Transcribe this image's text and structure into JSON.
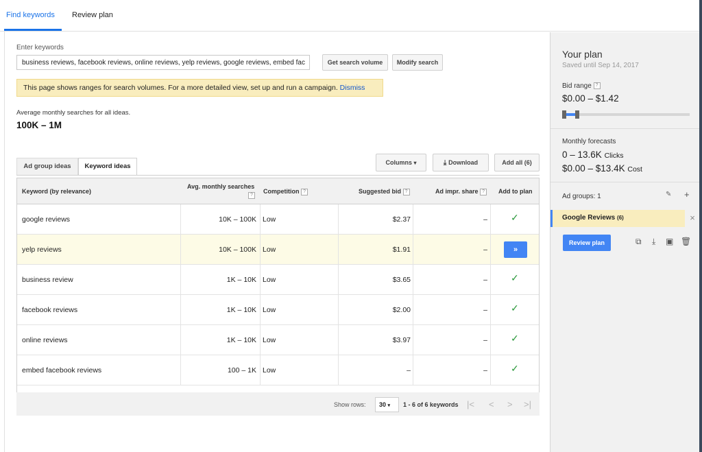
{
  "top_tabs": [
    "Find keywords",
    "Review plan"
  ],
  "search": {
    "label": "Enter keywords",
    "value": "business reviews, facebook reviews, online reviews, yelp reviews, google reviews, embed fac",
    "get_volume_label": "Get search volume",
    "modify_label": "Modify search"
  },
  "notice": {
    "text": "This page shows ranges for search volumes. For a more detailed view, set up and run a campaign.",
    "dismiss": "Dismiss"
  },
  "summary": {
    "avg_label": "Average monthly searches for all ideas.",
    "avg_value": "100K – 1M"
  },
  "tabs": {
    "ad_group": "Ad group ideas",
    "keyword": "Keyword ideas",
    "columns": "Columns",
    "download": "Download",
    "add_all": "Add all (6)"
  },
  "table": {
    "headers": {
      "keyword": "Keyword (by relevance)",
      "avg_line1": "Avg. monthly searches",
      "competition": "Competition",
      "bid": "Suggested bid",
      "impr": "Ad impr. share",
      "add": "Add to plan",
      "help": "?"
    },
    "rows": [
      {
        "keyword": "google reviews",
        "searches": "10K – 100K",
        "competition": "Low",
        "bid": "$2.37",
        "impr": "–",
        "added": true
      },
      {
        "keyword": "yelp reviews",
        "searches": "10K – 100K",
        "competition": "Low",
        "bid": "$1.91",
        "impr": "–",
        "added": false
      },
      {
        "keyword": "business review",
        "searches": "1K – 10K",
        "competition": "Low",
        "bid": "$3.65",
        "impr": "–",
        "added": true
      },
      {
        "keyword": "facebook reviews",
        "searches": "1K – 10K",
        "competition": "Low",
        "bid": "$2.00",
        "impr": "–",
        "added": true
      },
      {
        "keyword": "online reviews",
        "searches": "1K – 10K",
        "competition": "Low",
        "bid": "$3.97",
        "impr": "–",
        "added": true
      },
      {
        "keyword": "embed facebook reviews",
        "searches": "100 – 1K",
        "competition": "Low",
        "bid": "–",
        "impr": "–",
        "added": true
      }
    ],
    "check_glyph": "✓",
    "add_glyph": "»"
  },
  "pager": {
    "show_rows": "Show rows:",
    "rows_value": "30",
    "range": "1 - 6 of 6 keywords"
  },
  "plan": {
    "title": "Your plan",
    "saved": "Saved until Sep 14, 2017",
    "bid_range_label": "Bid range",
    "bid_range_value": "$0.00 – $1.42",
    "bid_slider_fraction": 0.1,
    "forecasts_label": "Monthly forecasts",
    "clicks_value": "0 – 13.6K",
    "clicks_unit": "Clicks",
    "cost_value": "$0.00 – $13.4K",
    "cost_unit": "Cost",
    "ad_groups_label": "Ad groups: 1",
    "ad_group_name": "Google Reviews",
    "ad_group_count": "(6)",
    "review_button": "Review plan"
  },
  "colors": {
    "accent": "#4285f4",
    "link": "#1155cc",
    "notice_bg": "#f9edbe",
    "check": "#2e9a3e"
  }
}
